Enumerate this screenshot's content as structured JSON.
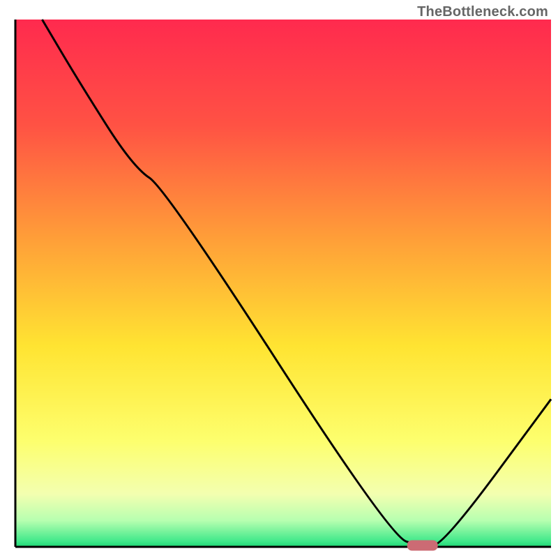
{
  "watermark": "TheBottleneck.com",
  "chart_data": {
    "type": "line",
    "title": "",
    "xlabel": "",
    "ylabel": "",
    "xlim": [
      0,
      100
    ],
    "ylim": [
      0,
      100
    ],
    "series": [
      {
        "name": "bottleneck-curve",
        "x": [
          5,
          12,
          22,
          28,
          70,
          76,
          80,
          100
        ],
        "y": [
          100,
          88,
          72,
          68,
          2,
          0,
          0.5,
          28
        ]
      }
    ],
    "marker": {
      "name": "optimal-point",
      "x": 76,
      "y": 0,
      "color": "#cc6b74"
    },
    "background": {
      "type": "vertical-gradient",
      "stops": [
        {
          "offset": 0,
          "color": "#ff2a4e"
        },
        {
          "offset": 20,
          "color": "#ff5244"
        },
        {
          "offset": 42,
          "color": "#ffa038"
        },
        {
          "offset": 62,
          "color": "#ffe432"
        },
        {
          "offset": 80,
          "color": "#fdff6e"
        },
        {
          "offset": 90,
          "color": "#f3ffb0"
        },
        {
          "offset": 95,
          "color": "#b7ffb0"
        },
        {
          "offset": 99,
          "color": "#3fe88a"
        },
        {
          "offset": 100,
          "color": "#1ed773"
        }
      ]
    },
    "axis_color": "#000000",
    "curve_color": "#000000",
    "curve_width": 3
  }
}
